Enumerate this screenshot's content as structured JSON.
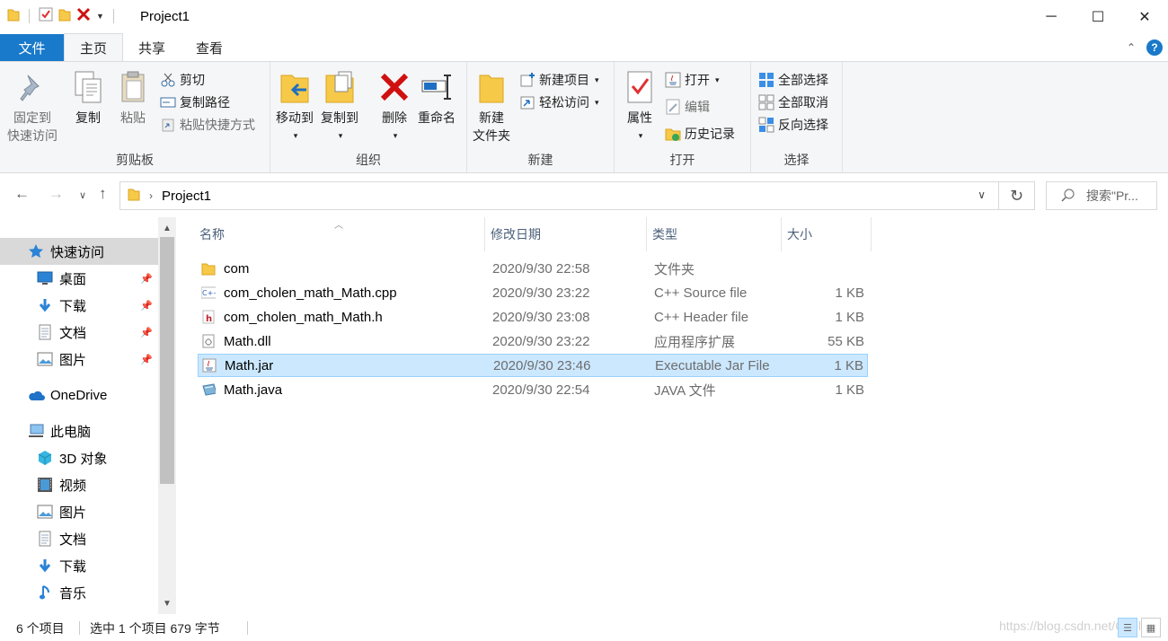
{
  "window": {
    "title": "Project1",
    "controls": {
      "minimize": "─",
      "maximize": "☐",
      "close": "✕"
    }
  },
  "ribbon_tabs": [
    "文件",
    "主页",
    "共享",
    "查看"
  ],
  "ribbon": {
    "clipboard": {
      "label": "剪贴板",
      "pin_line1": "固定到",
      "pin_line2": "快速访问",
      "copy": "复制",
      "paste": "粘贴",
      "cut": "剪切",
      "copy_path": "复制路径",
      "paste_shortcut": "粘贴快捷方式"
    },
    "organize": {
      "label": "组织",
      "move_to": "移动到",
      "copy_to": "复制到",
      "delete": "删除",
      "rename": "重命名"
    },
    "new": {
      "label": "新建",
      "new_folder_line1": "新建",
      "new_folder_line2": "文件夹",
      "new_item": "新建项目",
      "easy_access": "轻松访问"
    },
    "open": {
      "label": "打开",
      "properties": "属性",
      "open": "打开",
      "edit": "编辑",
      "history": "历史记录"
    },
    "select": {
      "label": "选择",
      "select_all": "全部选择",
      "select_none": "全部取消",
      "invert": "反向选择"
    }
  },
  "address_bar": {
    "path": "Project1",
    "search_placeholder": "搜索\"Pr..."
  },
  "sidebar": {
    "items": [
      {
        "label": "快速访问",
        "icon": "star-icon",
        "level": 0,
        "selected": true
      },
      {
        "label": "桌面",
        "icon": "desktop-icon",
        "level": 1,
        "pinned": true
      },
      {
        "label": "下载",
        "icon": "download-icon",
        "level": 1,
        "pinned": true
      },
      {
        "label": "文档",
        "icon": "document-icon",
        "level": 1,
        "pinned": true
      },
      {
        "label": "图片",
        "icon": "picture-icon",
        "level": 1,
        "pinned": true
      },
      {
        "label": "OneDrive",
        "icon": "cloud-icon",
        "level": 0
      },
      {
        "label": "此电脑",
        "icon": "computer-icon",
        "level": 0
      },
      {
        "label": "3D 对象",
        "icon": "cube-icon",
        "level": 1
      },
      {
        "label": "视频",
        "icon": "video-icon",
        "level": 1
      },
      {
        "label": "图片",
        "icon": "picture-icon",
        "level": 1
      },
      {
        "label": "文档",
        "icon": "document-icon",
        "level": 1
      },
      {
        "label": "下载",
        "icon": "download-icon",
        "level": 1
      },
      {
        "label": "音乐",
        "icon": "music-icon",
        "level": 1
      }
    ]
  },
  "columns": {
    "name": "名称",
    "date": "修改日期",
    "type": "类型",
    "size": "大小"
  },
  "files": [
    {
      "name": "com",
      "date": "2020/9/30 22:58",
      "type": "文件夹",
      "size": "",
      "icon": "folder-icon"
    },
    {
      "name": "com_cholen_math_Math.cpp",
      "date": "2020/9/30 23:22",
      "type": "C++ Source file",
      "size": "1 KB",
      "icon": "cpp-file-icon"
    },
    {
      "name": "com_cholen_math_Math.h",
      "date": "2020/9/30 23:08",
      "type": "C++ Header file",
      "size": "1 KB",
      "icon": "header-file-icon"
    },
    {
      "name": "Math.dll",
      "date": "2020/9/30 23:22",
      "type": "应用程序扩展",
      "size": "55 KB",
      "icon": "dll-file-icon"
    },
    {
      "name": "Math.jar",
      "date": "2020/9/30 23:46",
      "type": "Executable Jar File",
      "size": "1 KB",
      "icon": "jar-file-icon",
      "selected": true
    },
    {
      "name": "Math.java",
      "date": "2020/9/30 22:54",
      "type": "JAVA 文件",
      "size": "1 KB",
      "icon": "java-file-icon"
    }
  ],
  "status": {
    "count": "6 个项目",
    "selection": "选中 1 个项目  679 字节",
    "watermark": "https://blog.csdn.net/Chol"
  }
}
